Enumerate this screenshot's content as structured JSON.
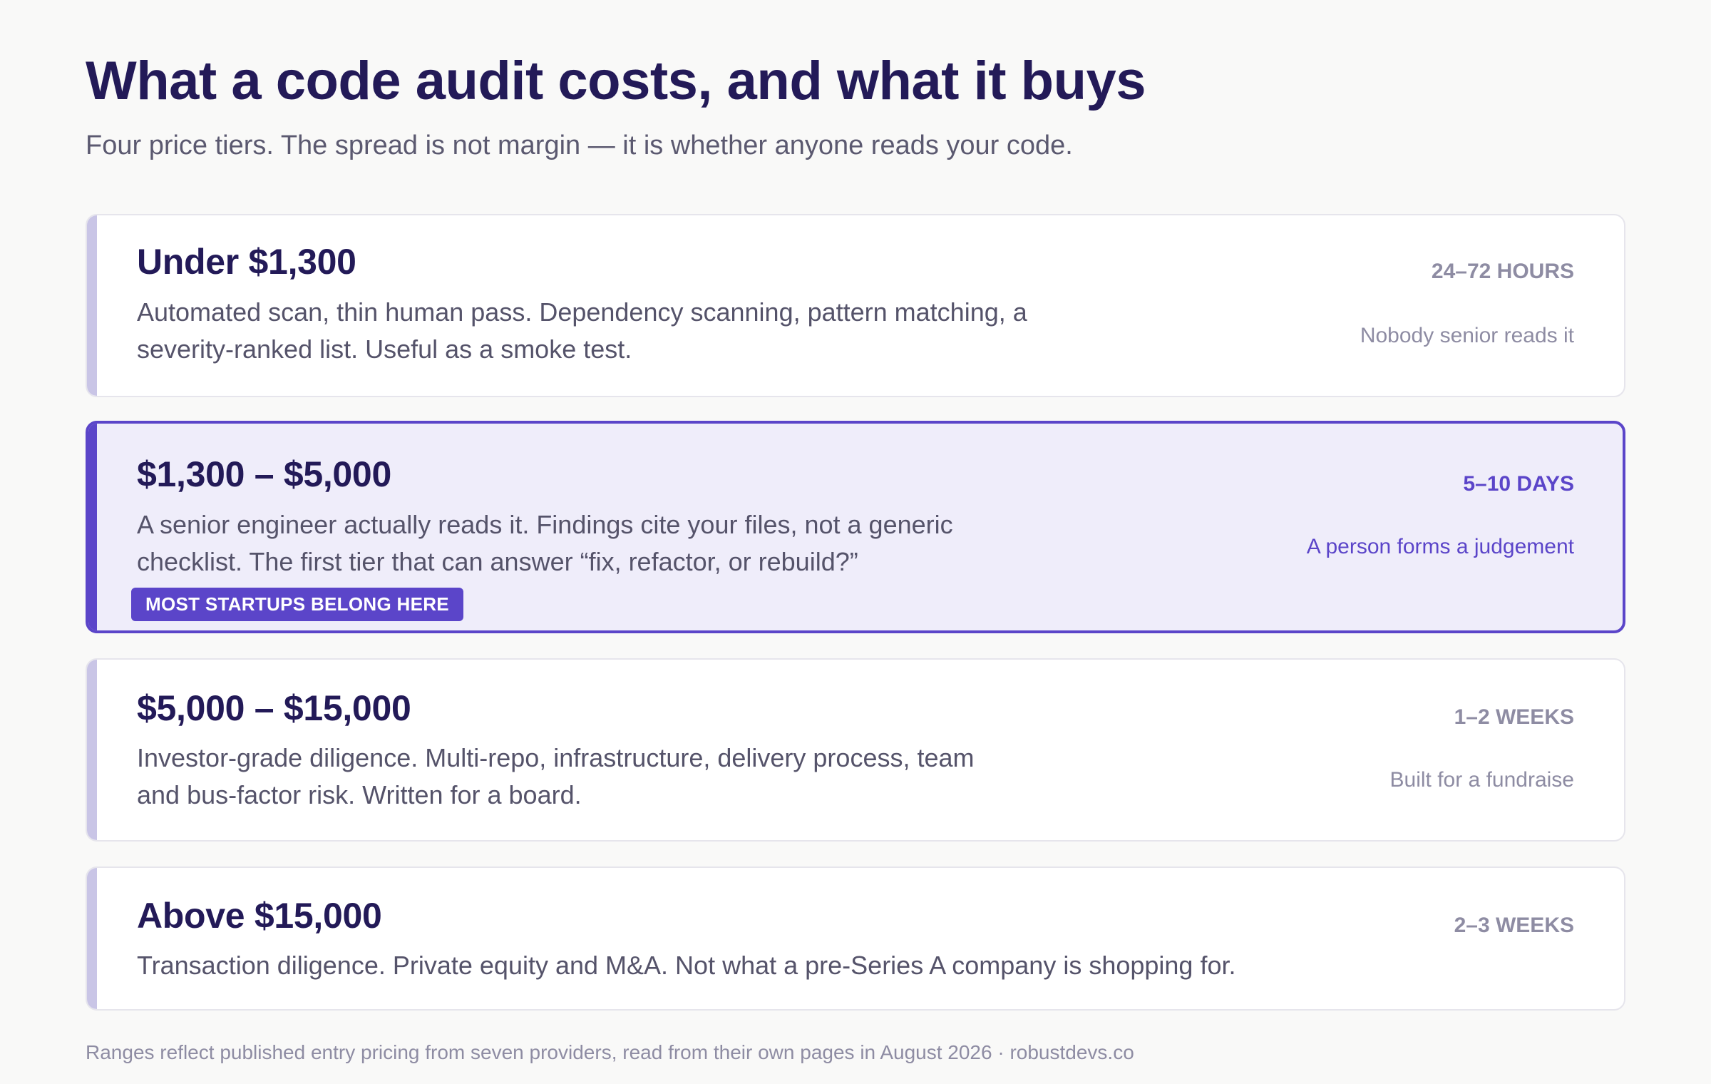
{
  "header": {
    "title": "What a code audit costs, and what it buys",
    "subtitle": "Four price tiers. The spread is not margin — it is whether anyone reads your code."
  },
  "tiers": [
    {
      "title": "Under $1,300",
      "description": "Automated scan, thin human pass. Dependency scanning, pattern matching, a severity-ranked list. Useful as a smoke test.",
      "duration": "24–72 HOURS",
      "note": "Nobody senior reads it"
    },
    {
      "title": "$1,300 – $5,000",
      "description": "A senior engineer actually reads it. Findings cite your files, not a generic checklist. The first tier that can answer “fix, refactor, or rebuild?”",
      "duration": "5–10 DAYS",
      "note": "A person forms a judgement",
      "badge": "MOST STARTUPS BELONG HERE",
      "featured": true
    },
    {
      "title": "$5,000 – $15,000",
      "description": "Investor-grade diligence. Multi-repo, infrastructure, delivery process, team and bus-factor risk. Written for a board.",
      "duration": "1–2 WEEKS",
      "note": "Built for a fundraise"
    },
    {
      "title": "Above $15,000",
      "description": "Transaction diligence. Private equity and M&A. Not what a pre-Series A company is shopping for.",
      "duration": "2–3 WEEKS",
      "note": ""
    }
  ],
  "footer": {
    "text": "Ranges reflect published entry pricing from seven providers, read from their own pages in August 2026 · robustdevs.co"
  },
  "colors": {
    "title": "#231a58",
    "accent": "#5b45c9",
    "accent_muted": "#c9c5e6",
    "featured_bg": "#efedfa",
    "muted_text": "#8e8ca3"
  }
}
